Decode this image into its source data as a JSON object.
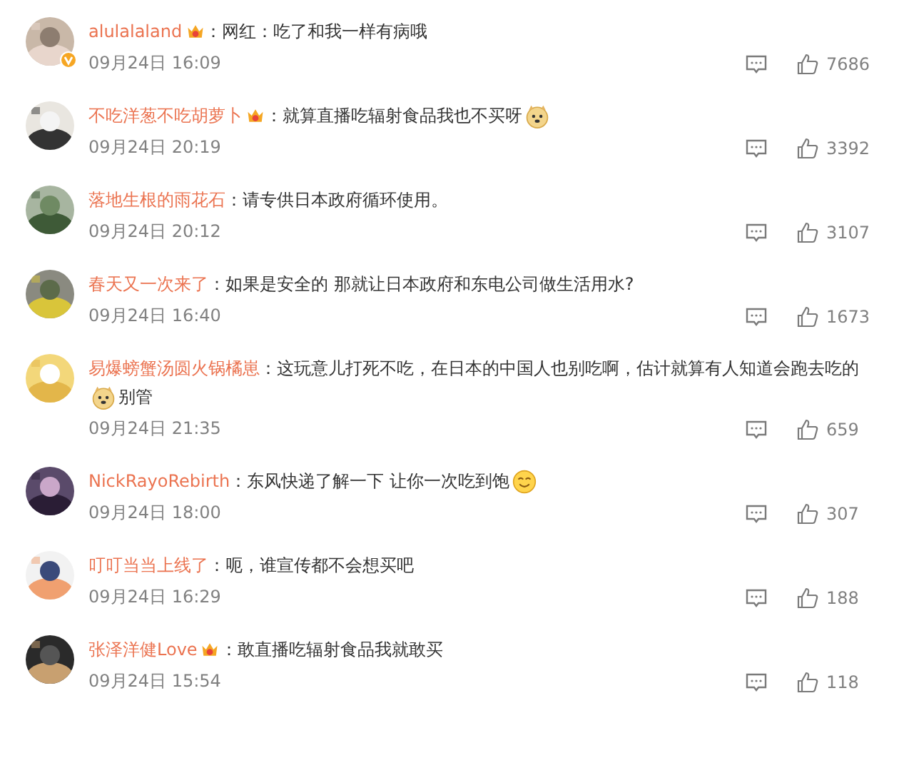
{
  "comments": [
    {
      "name": "alulalaland",
      "vip": true,
      "verified": true,
      "parts": [
        {
          "kind": "text",
          "text": "：网红：吃了和我一样有病哦"
        }
      ],
      "time": "09月24日 16:09",
      "likes": "7686"
    },
    {
      "name": "不吃洋葱不吃胡萝卜",
      "vip": true,
      "verified": false,
      "parts": [
        {
          "kind": "text",
          "text": "：就算直播吃辐射食品我也不买呀"
        },
        {
          "kind": "doge"
        }
      ],
      "time": "09月24日 20:19",
      "likes": "3392"
    },
    {
      "name": "落地生根的雨花石",
      "vip": false,
      "verified": false,
      "parts": [
        {
          "kind": "text",
          "text": "：请专供日本政府循环使用。"
        }
      ],
      "time": "09月24日 20:12",
      "likes": "3107"
    },
    {
      "name": "春天又一次来了",
      "vip": false,
      "verified": false,
      "parts": [
        {
          "kind": "text",
          "text": "：如果是安全的 那就让日本政府和东电公司做生活用水?"
        }
      ],
      "time": "09月24日 16:40",
      "likes": "1673"
    },
    {
      "name": "易爆螃蟹汤圆火锅橘崽",
      "vip": false,
      "verified": false,
      "parts": [
        {
          "kind": "text",
          "text": "：这玩意儿打死不吃，在日本的中国人也别吃啊，估计就算有人知道会跑去吃的"
        },
        {
          "kind": "doge"
        },
        {
          "kind": "text",
          "text": "别管"
        }
      ],
      "time": "09月24日 21:35",
      "likes": "659"
    },
    {
      "name": "NickRayoRebirth",
      "vip": false,
      "verified": false,
      "parts": [
        {
          "kind": "text",
          "text": "：东风快递了解一下 让你一次吃到饱"
        },
        {
          "kind": "smile"
        }
      ],
      "time": "09月24日 18:00",
      "likes": "307"
    },
    {
      "name": "叮叮当当上线了",
      "vip": false,
      "verified": false,
      "parts": [
        {
          "kind": "text",
          "text": "：呃，谁宣传都不会想买吧"
        }
      ],
      "time": "09月24日 16:29",
      "likes": "188"
    },
    {
      "name": "张泽洋健Love",
      "vip": true,
      "verified": false,
      "parts": [
        {
          "kind": "text",
          "text": "：敢直播吃辐射食品我就敢买"
        }
      ],
      "time": "09月24日 15:54",
      "likes": "118"
    }
  ]
}
